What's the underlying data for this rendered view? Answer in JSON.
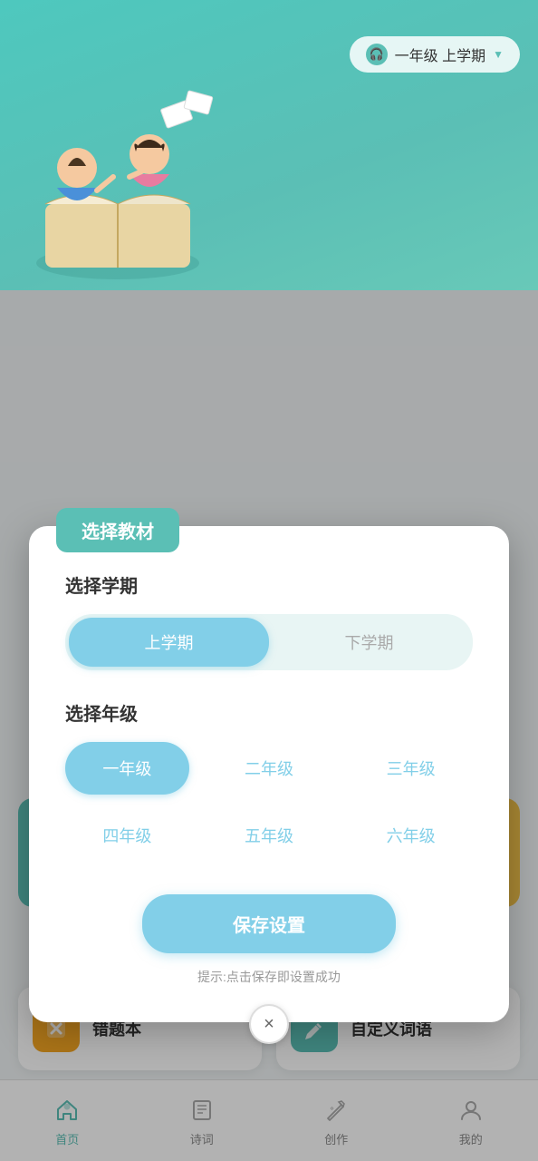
{
  "header": {
    "grade_label": "一年级  上学期",
    "dropdown_arrow": "▼"
  },
  "modal": {
    "header_tag": "选择教材",
    "semester_section_title": "选择学期",
    "semester_options": [
      {
        "label": "上学期",
        "active": true
      },
      {
        "label": "下学期",
        "active": false
      }
    ],
    "grade_section_title": "选择年级",
    "grade_options": [
      {
        "label": "一年级",
        "active": true
      },
      {
        "label": "二年级",
        "active": false
      },
      {
        "label": "三年级",
        "active": false
      },
      {
        "label": "四年级",
        "active": false
      },
      {
        "label": "五年级",
        "active": false
      },
      {
        "label": "六年级",
        "active": false
      }
    ],
    "save_button_label": "保存设置",
    "hint_text": "提示:点击保存即设置成功"
  },
  "feature_cards": [
    {
      "label": "错题本",
      "icon_type": "orange",
      "icon_char": "✕"
    },
    {
      "label": "自定义词语",
      "icon_type": "blue",
      "icon_char": "✎"
    }
  ],
  "bottom_nav": [
    {
      "label": "首页",
      "active": true,
      "icon": "home"
    },
    {
      "label": "诗词",
      "active": false,
      "icon": "book"
    },
    {
      "label": "创作",
      "active": false,
      "icon": "edit"
    },
    {
      "label": "我的",
      "active": false,
      "icon": "user"
    }
  ],
  "close_icon": "×"
}
